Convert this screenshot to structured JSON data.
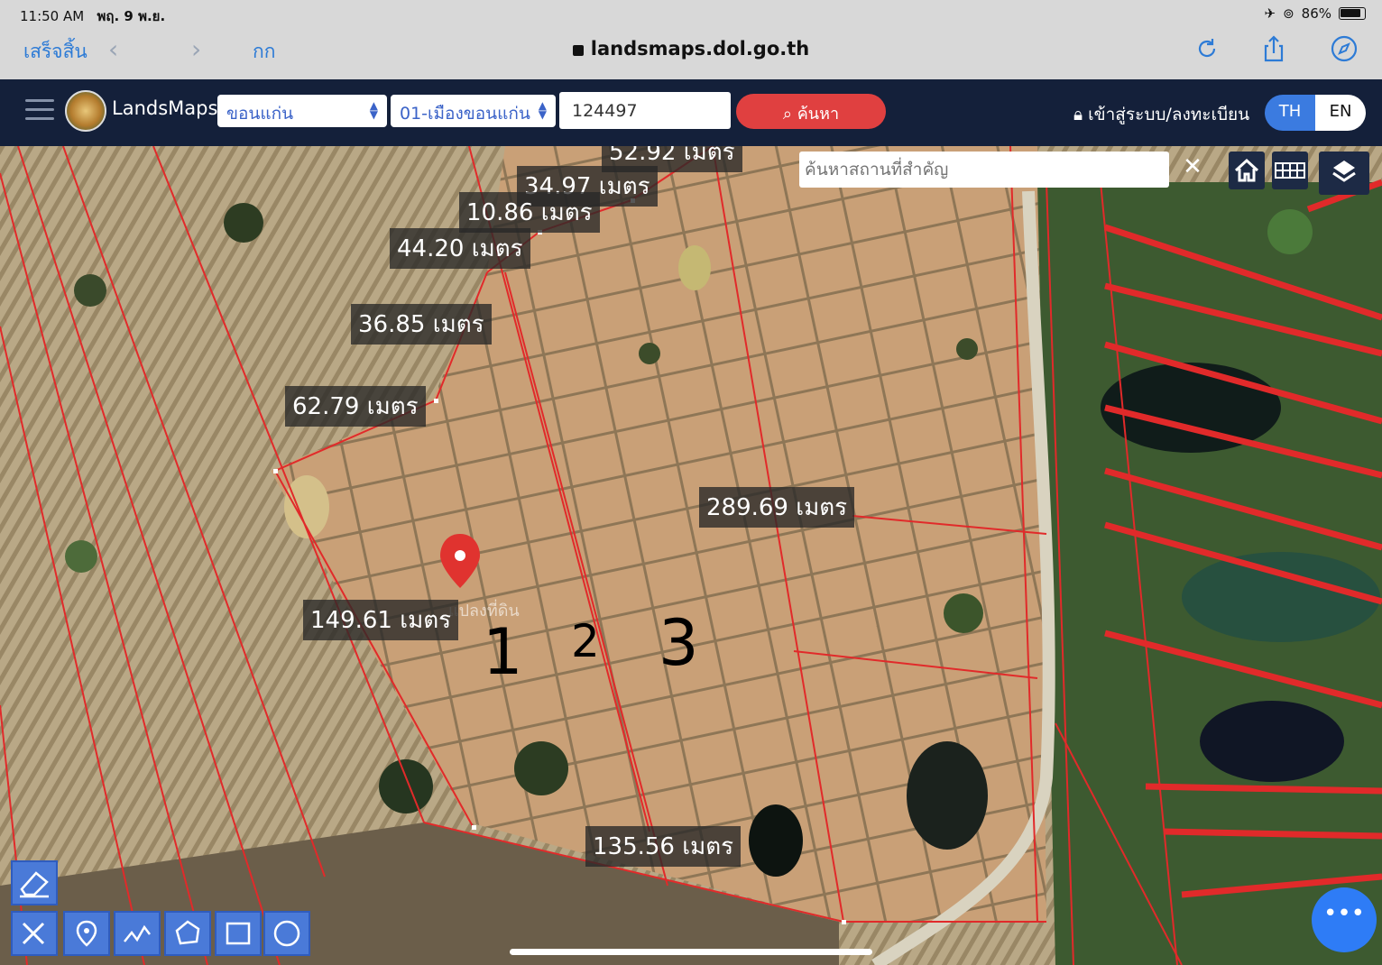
{
  "status_bar": {
    "time": "11:50 AM",
    "date": "พฤ. 9 พ.ย.",
    "battery": "86%"
  },
  "safari": {
    "done_label": "เสร็จสิ้น",
    "aa_label": "กก",
    "url": "landsmaps.dol.go.th"
  },
  "header": {
    "brand": "LandsMaps",
    "province": "ขอนแก่น",
    "district": "01-เมืองขอนแก่น",
    "deed_number": "124497",
    "search_label": "ค้นหา",
    "login_label": "เข้าสู่ระบบ/ลงทะเบียน",
    "lang_th": "TH",
    "lang_en": "EN"
  },
  "map": {
    "place_search_placeholder": "ค้นหาสถานที่สำคัญ",
    "pin_label": "แปลงที่ดิน",
    "measurements": {
      "m0": "52.92 เมตร",
      "m1": "34.97 เมตร",
      "m2": "10.86 เมตร",
      "m3": "44.20 เมตร",
      "m4": "36.85 เมตร",
      "m5": "62.79 เมตร",
      "m6": "289.69 เมตร",
      "m7": "149.61 เมตร",
      "m8": "135.56 เมตร"
    },
    "plot_numbers": {
      "p1": "1",
      "p2": "2",
      "p3": "3"
    },
    "fab_label": "•••"
  }
}
